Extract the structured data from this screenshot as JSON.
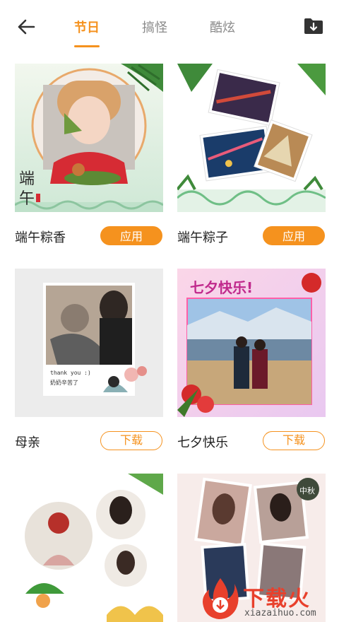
{
  "header": {
    "tabs": [
      {
        "label": "节日",
        "active": true
      },
      {
        "label": "搞怪",
        "active": false
      },
      {
        "label": "酷炫",
        "active": false
      }
    ],
    "back_icon": "back-arrow-icon",
    "download_icon": "folder-download-icon"
  },
  "cards": [
    {
      "name": "端午粽香",
      "button": "应用"
    },
    {
      "name": "端午粽子",
      "button": "应用"
    },
    {
      "name": "母亲",
      "button": "下载"
    },
    {
      "name": "七夕快乐",
      "button": "下载"
    },
    {
      "name": "",
      "button": ""
    },
    {
      "name": "",
      "button": ""
    }
  ],
  "thumb_text": {
    "duanwu_calligraphy_1": "端",
    "duanwu_calligraphy_2": "午",
    "mother_note_1": "thank you :)",
    "mother_note_2": "奶奶辛苦了",
    "qixi_banner": "七夕快乐!",
    "midautumn_tag": "中秋"
  },
  "watermark": {
    "text": "下载火",
    "url": "xiazaihuo.com"
  },
  "colors": {
    "accent": "#f5921e",
    "watermark": "#e8402c"
  }
}
